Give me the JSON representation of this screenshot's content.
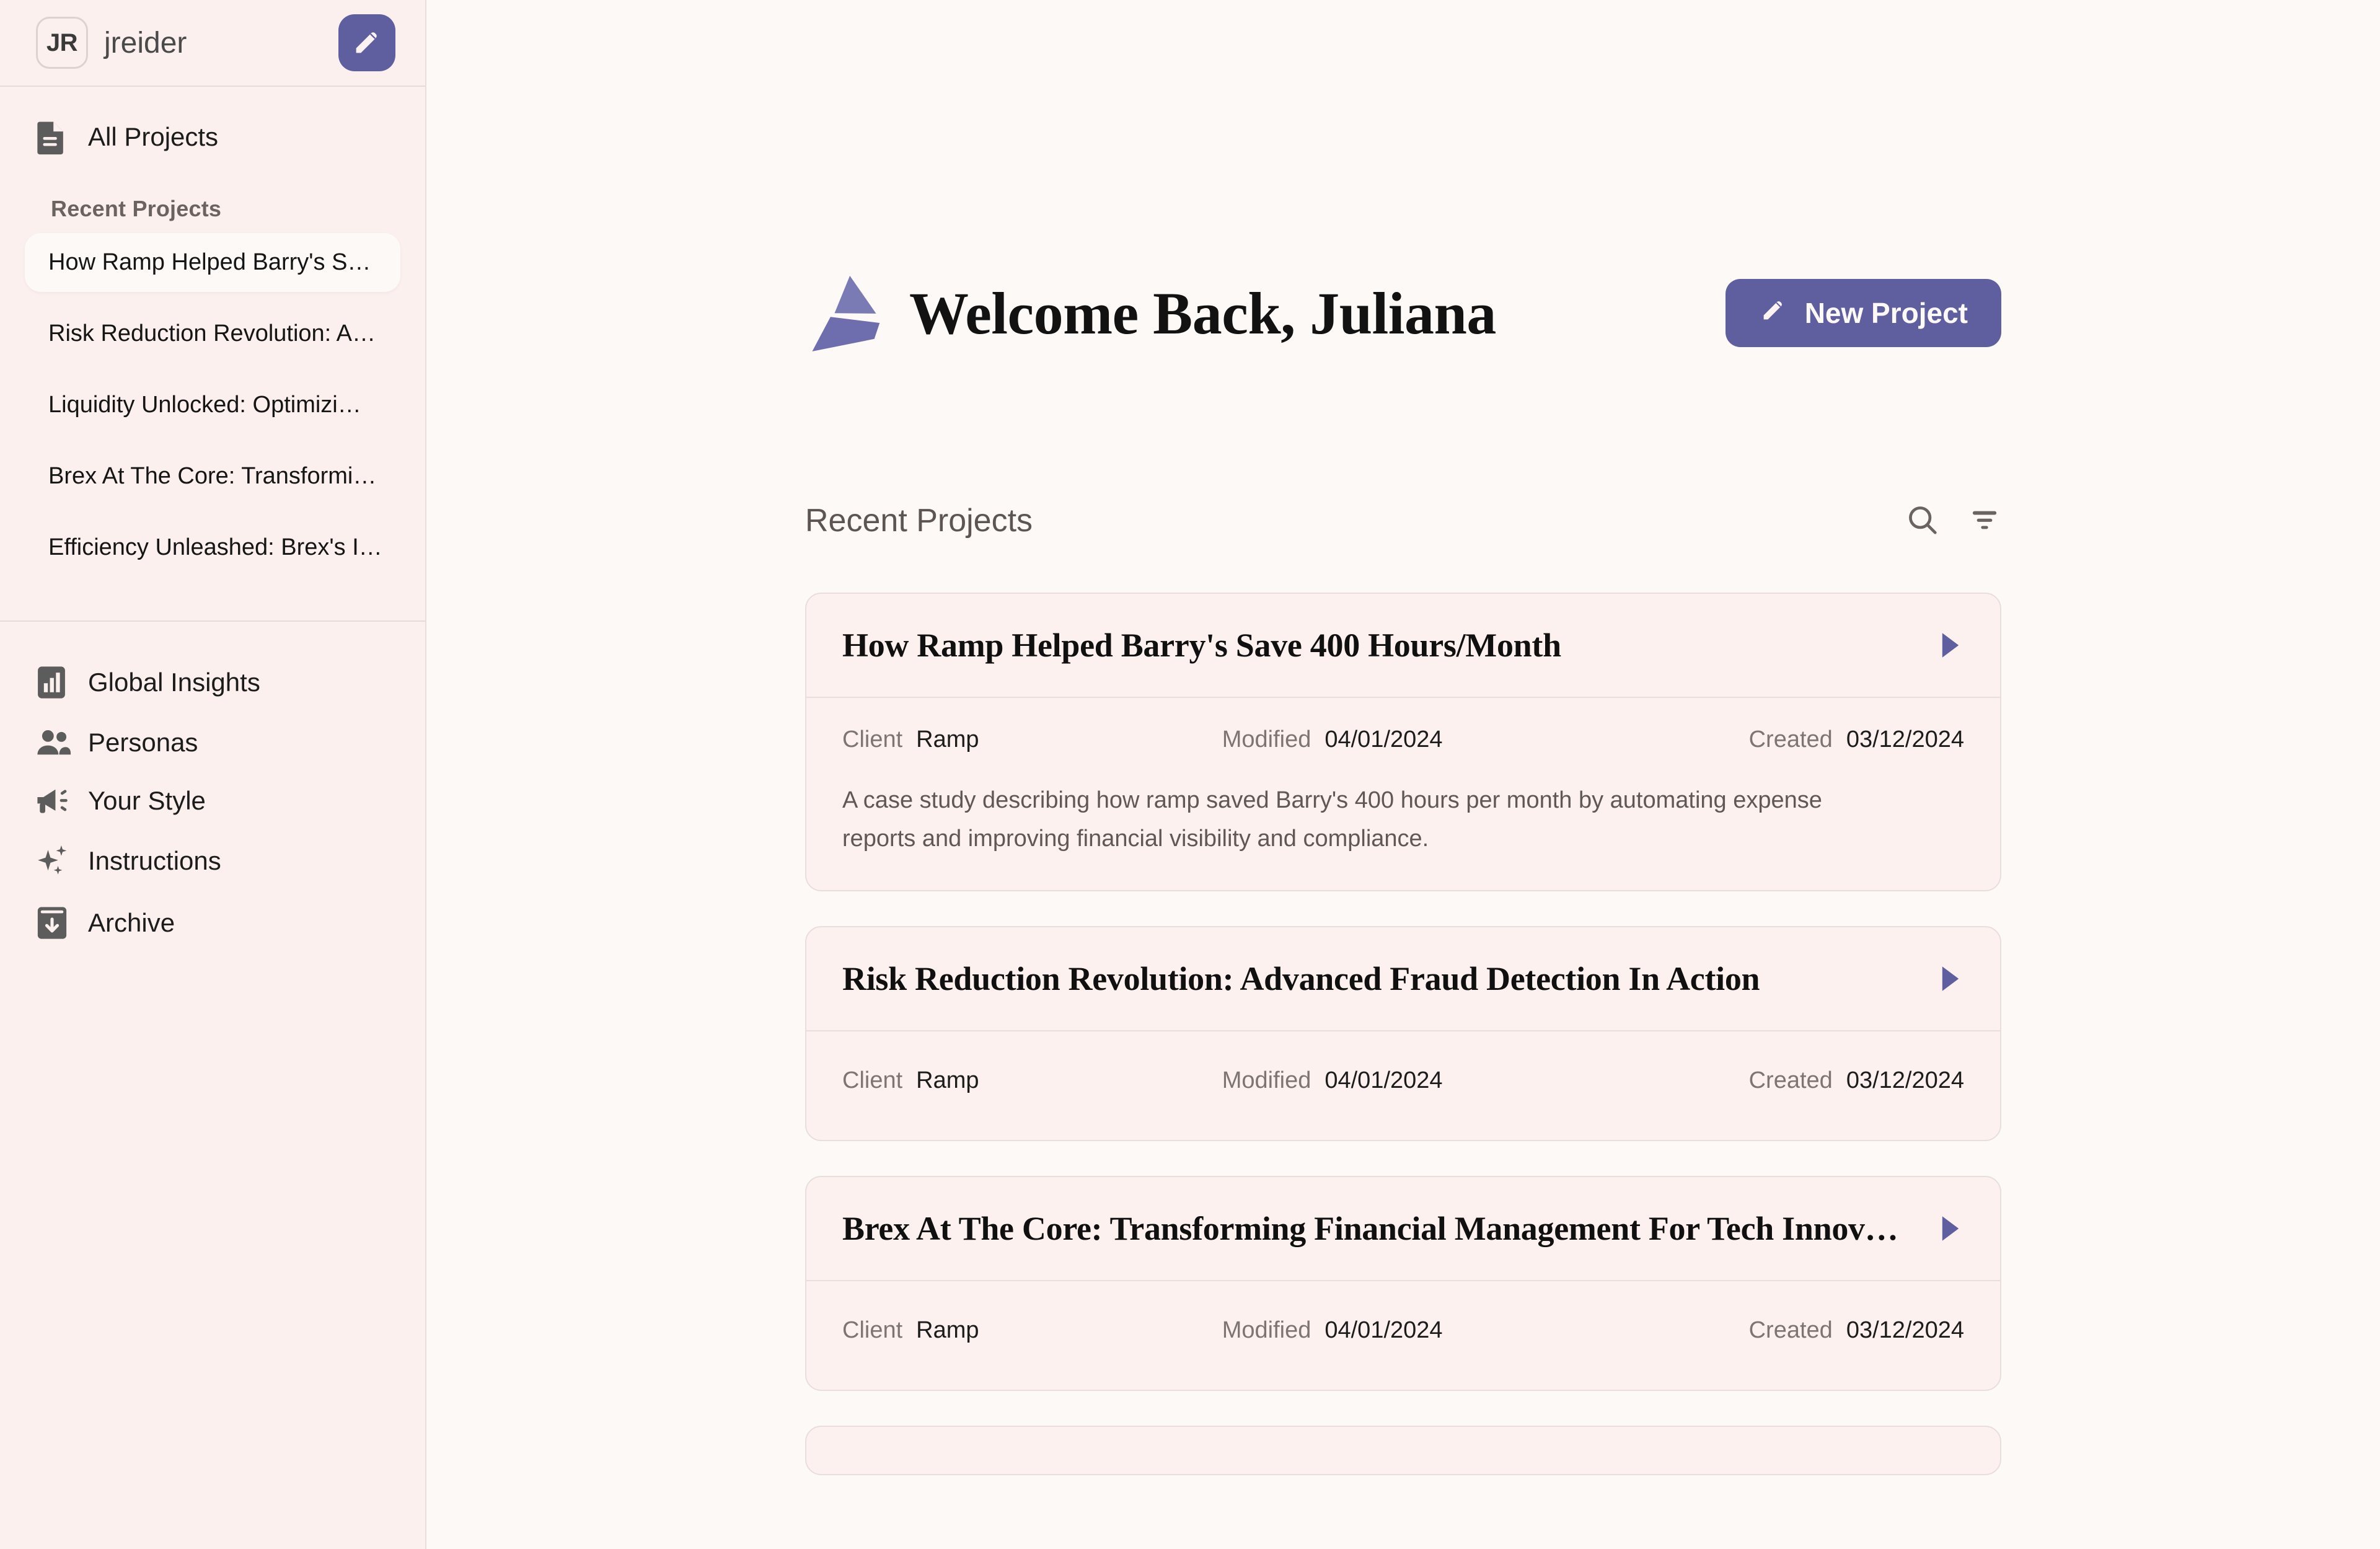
{
  "sidebar": {
    "user": {
      "initials": "JR",
      "name": "jreider",
      "edit_icon": "pencil-icon"
    },
    "all_projects": {
      "label": "All Projects",
      "icon": "document-icon"
    },
    "recent_label": "Recent Projects",
    "recent_items": [
      {
        "label": "How Ramp Helped Barry's S…",
        "selected": true
      },
      {
        "label": "Risk Reduction Revolution: A…",
        "selected": false
      },
      {
        "label": "Liquidity Unlocked: Optimizi…",
        "selected": false
      },
      {
        "label": "Brex At The Core: Transformi…",
        "selected": false
      },
      {
        "label": "Efficiency Unleashed: Brex's I…",
        "selected": false
      }
    ],
    "nav_bottom": [
      {
        "label": "Global Insights",
        "icon": "bar-chart-icon"
      },
      {
        "label": "Personas",
        "icon": "people-icon"
      },
      {
        "label": "Your Style",
        "icon": "megaphone-icon"
      },
      {
        "label": "Instructions",
        "icon": "sparkles-icon"
      },
      {
        "label": "Archive",
        "icon": "archive-icon"
      }
    ]
  },
  "header": {
    "logo_icon": "brand-triangle-logo",
    "title": "Welcome Back, Juliana",
    "new_project_label": "New Project",
    "new_project_icon": "pencil-icon"
  },
  "recent_section": {
    "title": "Recent Projects",
    "search_icon": "search-icon",
    "filter_icon": "filter-icon"
  },
  "labels": {
    "client": "Client",
    "modified": "Modified",
    "created": "Created"
  },
  "projects": [
    {
      "title": "How Ramp Helped Barry's Save 400 Hours/Month",
      "client": "Ramp",
      "modified": "04/01/2024",
      "created": "03/12/2024",
      "description": "A case study describing how ramp saved Barry's 400 hours per month by automating expense reports and improving financial visibility and compliance."
    },
    {
      "title": "Risk Reduction Revolution: Advanced Fraud Detection In Action",
      "client": "Ramp",
      "modified": "04/01/2024",
      "created": "03/12/2024",
      "description": ""
    },
    {
      "title": "Brex At The Core: Transforming Financial Management For Tech Innov…",
      "client": "Ramp",
      "modified": "04/01/2024",
      "created": "03/12/2024",
      "description": ""
    }
  ],
  "colors": {
    "accent_purple": "#5f5fa0",
    "sidebar_bg": "#fcf0ee",
    "main_bg": "#fdf9f6",
    "card_bg": "#fdf1ef",
    "border": "#e8dedb"
  }
}
